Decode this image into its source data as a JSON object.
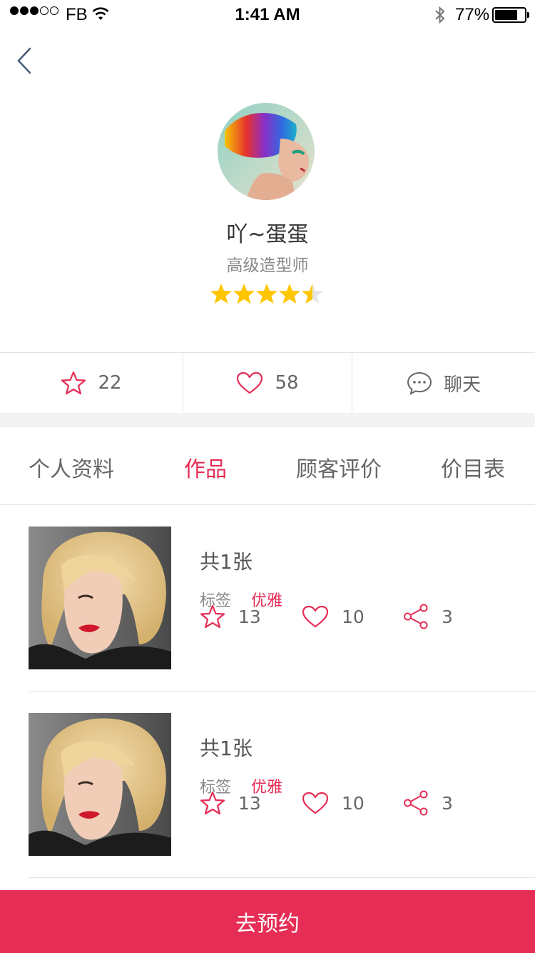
{
  "status_bar": {
    "carrier": "FB",
    "time": "1:41 AM",
    "battery": "77%"
  },
  "profile": {
    "name": "吖~蛋蛋",
    "title": "高级造型师",
    "rating": 4.5
  },
  "stats": {
    "favorites": "22",
    "likes": "58",
    "chat_label": "聊天"
  },
  "tabs": [
    {
      "label": "个人资料",
      "active": false
    },
    {
      "label": "作品",
      "active": true
    },
    {
      "label": "顾客评价",
      "active": false
    },
    {
      "label": "价目表",
      "active": false
    }
  ],
  "works": [
    {
      "count": "共1张",
      "tag_label": "标签",
      "tag": "优雅",
      "favorites": "13",
      "likes": "10",
      "shares": "3"
    },
    {
      "count": "共1张",
      "tag_label": "标签",
      "tag": "优雅",
      "favorites": "13",
      "likes": "10",
      "shares": "3"
    }
  ],
  "book_button": "去预约",
  "colors": {
    "accent": "#e62d55",
    "star": "#ffc600",
    "divider": "#e3e3e3"
  }
}
